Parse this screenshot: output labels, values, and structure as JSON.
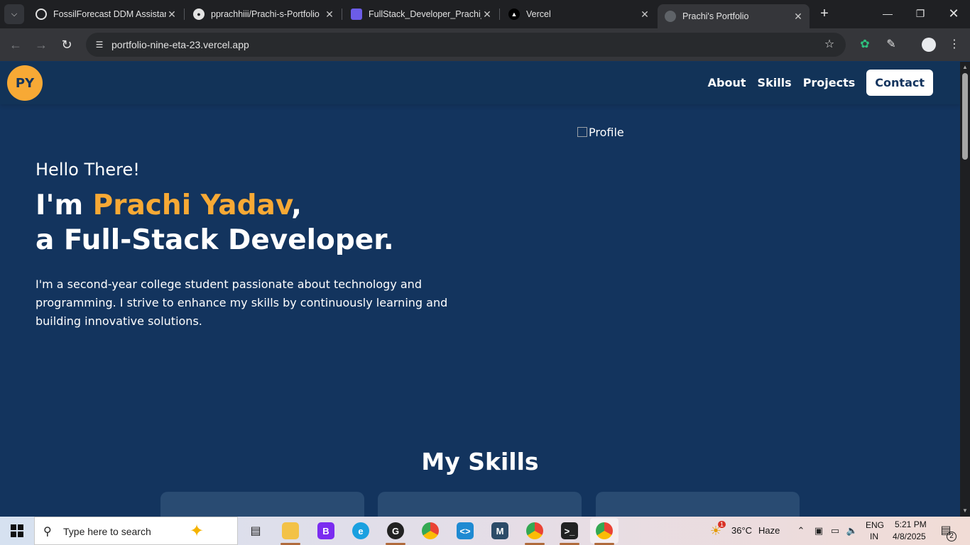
{
  "browser": {
    "tabs": [
      {
        "title": "FossilForecast DDM Assistan",
        "icon": "ai-swirl-icon",
        "active": false
      },
      {
        "title": "pprachhiii/Prachi-s-Portfolio",
        "icon": "github-icon",
        "active": false
      },
      {
        "title": "FullStack_Developer_Prachi_Y",
        "icon": "document-icon",
        "active": false
      },
      {
        "title": "Vercel",
        "icon": "vercel-triangle-icon",
        "active": false
      },
      {
        "title": "Prachi's Portfolio",
        "icon": "globe-icon",
        "active": true
      }
    ],
    "url": "portfolio-nine-eta-23.vercel.app"
  },
  "site": {
    "logo": "PY",
    "nav": {
      "about": "About",
      "skills": "Skills",
      "projects": "Projects",
      "contact": "Contact"
    },
    "profile_alt": "Profile",
    "hero": {
      "greeting": "Hello There!",
      "intro_prefix": "I'm ",
      "name": "Prachi Yadav",
      "intro_suffix": ",",
      "role": "a Full-Stack Developer.",
      "description": "I'm a second-year college student passionate about technology and programming. I strive to enhance my skills by continuously learning and building innovative solutions."
    },
    "skills_heading": "My Skills",
    "colors": {
      "background": "#13345e",
      "accent": "#f7a935",
      "card": "#294b72"
    }
  },
  "taskbar": {
    "search_placeholder": "Type here to search",
    "weather_temp": "36°C",
    "weather_desc": "Haze",
    "weather_badge": "1",
    "language": "ENG",
    "region": "IN",
    "time": "5:21 PM",
    "date": "4/8/2025",
    "notification_count": "2"
  }
}
